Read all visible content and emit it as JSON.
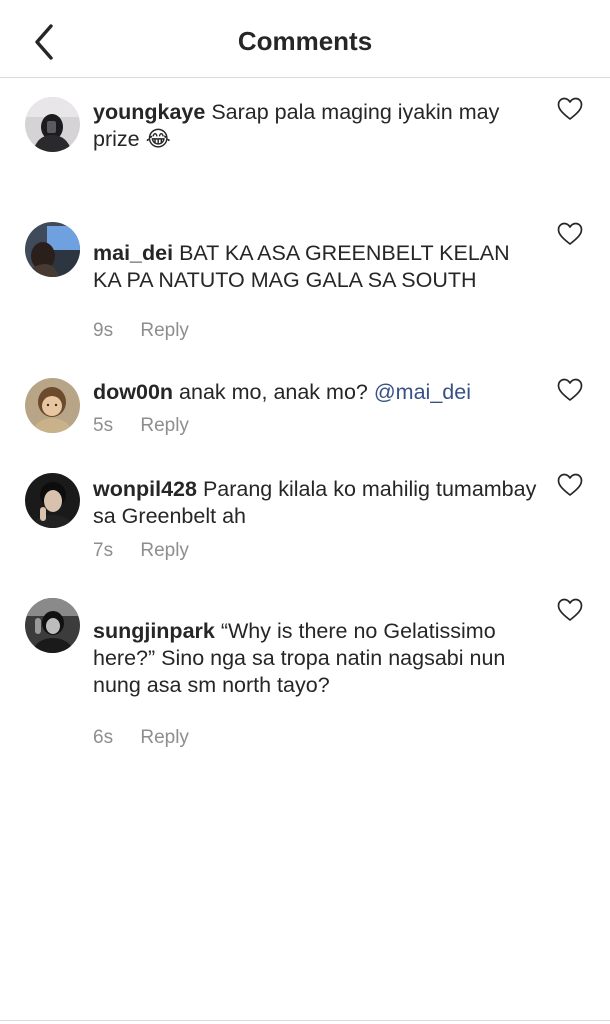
{
  "header": {
    "title": "Comments",
    "back_icon": "chevron-left-icon"
  },
  "colors": {
    "text": "#262626",
    "meta": "#8e8e8e",
    "mention": "#385185",
    "divider": "#dbdbdb"
  },
  "comments": [
    {
      "username": "youngkaye",
      "text": "Sarap pala maging iyakin may prize 😂",
      "time": "",
      "reply_label": "",
      "like_icon": "heart-outline-icon"
    },
    {
      "username": "mai_dei",
      "text": "BAT KA ASA GREENBELT KELAN KA PA NATUTO MAG GALA SA SOUTH",
      "time": "9s",
      "reply_label": "Reply",
      "like_icon": "heart-outline-icon"
    },
    {
      "username": "dow00n",
      "text": "anak mo, anak mo?",
      "mention": "@mai_dei",
      "time": "5s",
      "reply_label": "Reply",
      "like_icon": "heart-outline-icon"
    },
    {
      "username": "wonpil428",
      "text": "Parang kilala ko mahilig tumambay sa Greenbelt ah",
      "time": "7s",
      "reply_label": "Reply",
      "like_icon": "heart-outline-icon"
    },
    {
      "username": "sungjinpark",
      "text": "“Why is there no Gelatissimo here?” Sino nga sa tropa natin nagsabi nun nung asa sm north tayo?",
      "time": "6s",
      "reply_label": "Reply",
      "like_icon": "heart-outline-icon"
    }
  ]
}
